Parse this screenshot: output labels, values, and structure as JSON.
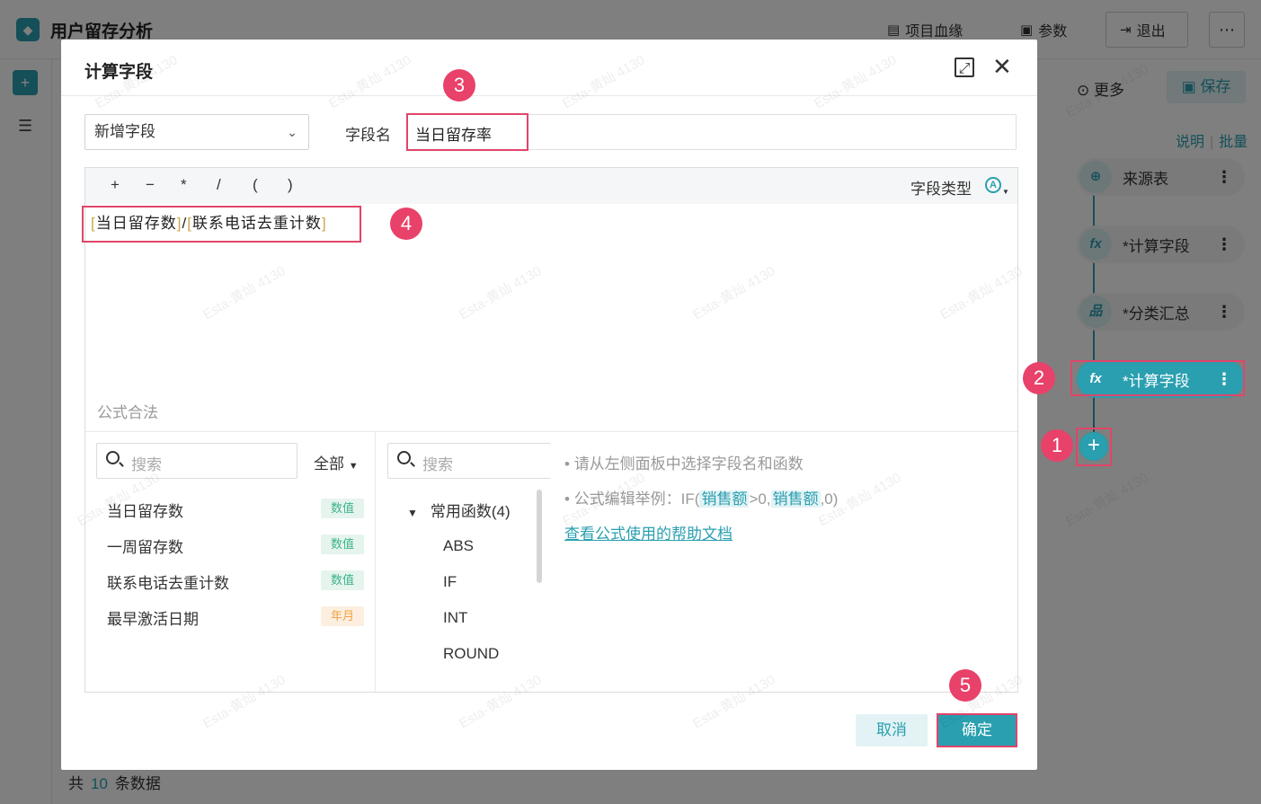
{
  "app": {
    "title": "用户留存分析",
    "header": {
      "lineage_label": "项目血缘",
      "params_label": "参数",
      "exit_label": "退出"
    }
  },
  "right_panel": {
    "more_label": "更多",
    "save_label": "保存",
    "tab_explain": "说明",
    "tab_batch": "批量",
    "nodes": [
      {
        "label": "来源表",
        "icon": "target-icon"
      },
      {
        "label": "*计算字段",
        "icon": "fx-icon"
      },
      {
        "label": "*分类汇总",
        "icon": "hierarchy-icon"
      },
      {
        "label": "*计算字段",
        "icon": "fx-icon"
      }
    ]
  },
  "footer": {
    "prefix": "共",
    "count": "10",
    "suffix": "条数据"
  },
  "dialog": {
    "title": "计算字段",
    "mode_select": "新增字段",
    "field_name_label": "字段名",
    "field_name_value": "当日留存率",
    "operators": [
      "+",
      "−",
      "*",
      "/",
      "(",
      ")"
    ],
    "field_type_label": "字段类型",
    "formula": {
      "left_field": "当日留存数",
      "operator": "/",
      "right_field": "联系电话去重计数"
    },
    "validation_hint": "公式合法",
    "fields_panel": {
      "search_placeholder": "搜索",
      "filter_label": "全部",
      "items": [
        {
          "name": "当日留存数",
          "type": "数值"
        },
        {
          "name": "一周留存数",
          "type": "数值"
        },
        {
          "name": "联系电话去重计数",
          "type": "数值"
        },
        {
          "name": "最早激活日期",
          "type": "年月"
        }
      ]
    },
    "functions_panel": {
      "search_placeholder": "搜索",
      "group_label": "常用函数(4)",
      "items": [
        "ABS",
        "IF",
        "INT",
        "ROUND"
      ]
    },
    "help": {
      "line1": "请从左侧面板中选择字段名和函数",
      "example_prefix": "公式编辑举例：IF(",
      "example_field1": "销售额",
      "example_mid": ">0,",
      "example_field2": "销售额",
      "example_suffix": ",0)",
      "link": "查看公式使用的帮助文档"
    },
    "cancel_label": "取消",
    "ok_label": "确定"
  },
  "steps": [
    "1",
    "2",
    "3",
    "4",
    "5"
  ],
  "watermark": "Esta-黄灿 4130",
  "colors": {
    "accent": "#2a9fb0",
    "highlight": "#e0456a",
    "badge": "#e8416a"
  }
}
